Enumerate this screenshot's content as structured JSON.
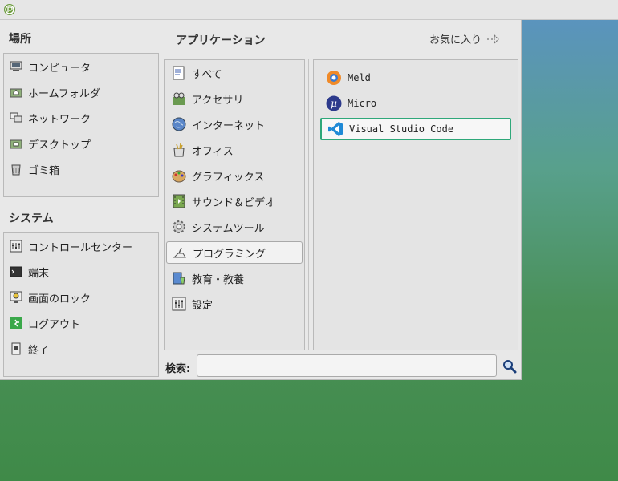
{
  "menu": {
    "places": {
      "title": "場所",
      "items": [
        {
          "label": "コンピュータ",
          "icon": "computer-icon"
        },
        {
          "label": "ホームフォルダ",
          "icon": "home-folder-icon"
        },
        {
          "label": "ネットワーク",
          "icon": "network-icon"
        },
        {
          "label": "デスクトップ",
          "icon": "desktop-folder-icon"
        },
        {
          "label": "ゴミ箱",
          "icon": "trash-icon"
        }
      ]
    },
    "system": {
      "title": "システム",
      "items": [
        {
          "label": "コントロールセンター",
          "icon": "control-center-icon"
        },
        {
          "label": "端末",
          "icon": "terminal-icon"
        },
        {
          "label": "画面のロック",
          "icon": "lock-screen-icon"
        },
        {
          "label": "ログアウト",
          "icon": "logout-icon"
        },
        {
          "label": "終了",
          "icon": "shutdown-icon"
        }
      ]
    },
    "applications": {
      "title": "アプリケーション",
      "favorites_label": "お気に入り",
      "categories": [
        {
          "label": "すべて",
          "icon": "all-apps-icon"
        },
        {
          "label": "アクセサリ",
          "icon": "accessories-icon"
        },
        {
          "label": "インターネット",
          "icon": "internet-globe-icon"
        },
        {
          "label": "オフィス",
          "icon": "office-icon"
        },
        {
          "label": "グラフィックス",
          "icon": "graphics-palette-icon"
        },
        {
          "label": "サウンド＆ビデオ",
          "icon": "sound-video-icon"
        },
        {
          "label": "システムツール",
          "icon": "system-tools-gear-icon"
        },
        {
          "label": "プログラミング",
          "icon": "programming-icon",
          "selected": true
        },
        {
          "label": "教育・教養",
          "icon": "education-icon"
        },
        {
          "label": "設定",
          "icon": "settings-icon"
        }
      ],
      "apps": [
        {
          "label": "Meld",
          "icon": "meld-icon"
        },
        {
          "label": "Micro",
          "icon": "micro-icon"
        },
        {
          "label": "Visual Studio Code",
          "icon": "vscode-icon",
          "selected": true
        }
      ]
    },
    "search": {
      "label": "検索:",
      "value": "",
      "placeholder": ""
    }
  },
  "colors": {
    "selection_border": "#2fa87a",
    "menu_bg": "#e8e8e8",
    "vscode_blue": "#1f8ad6",
    "micro_blue": "#2d3a8c"
  }
}
